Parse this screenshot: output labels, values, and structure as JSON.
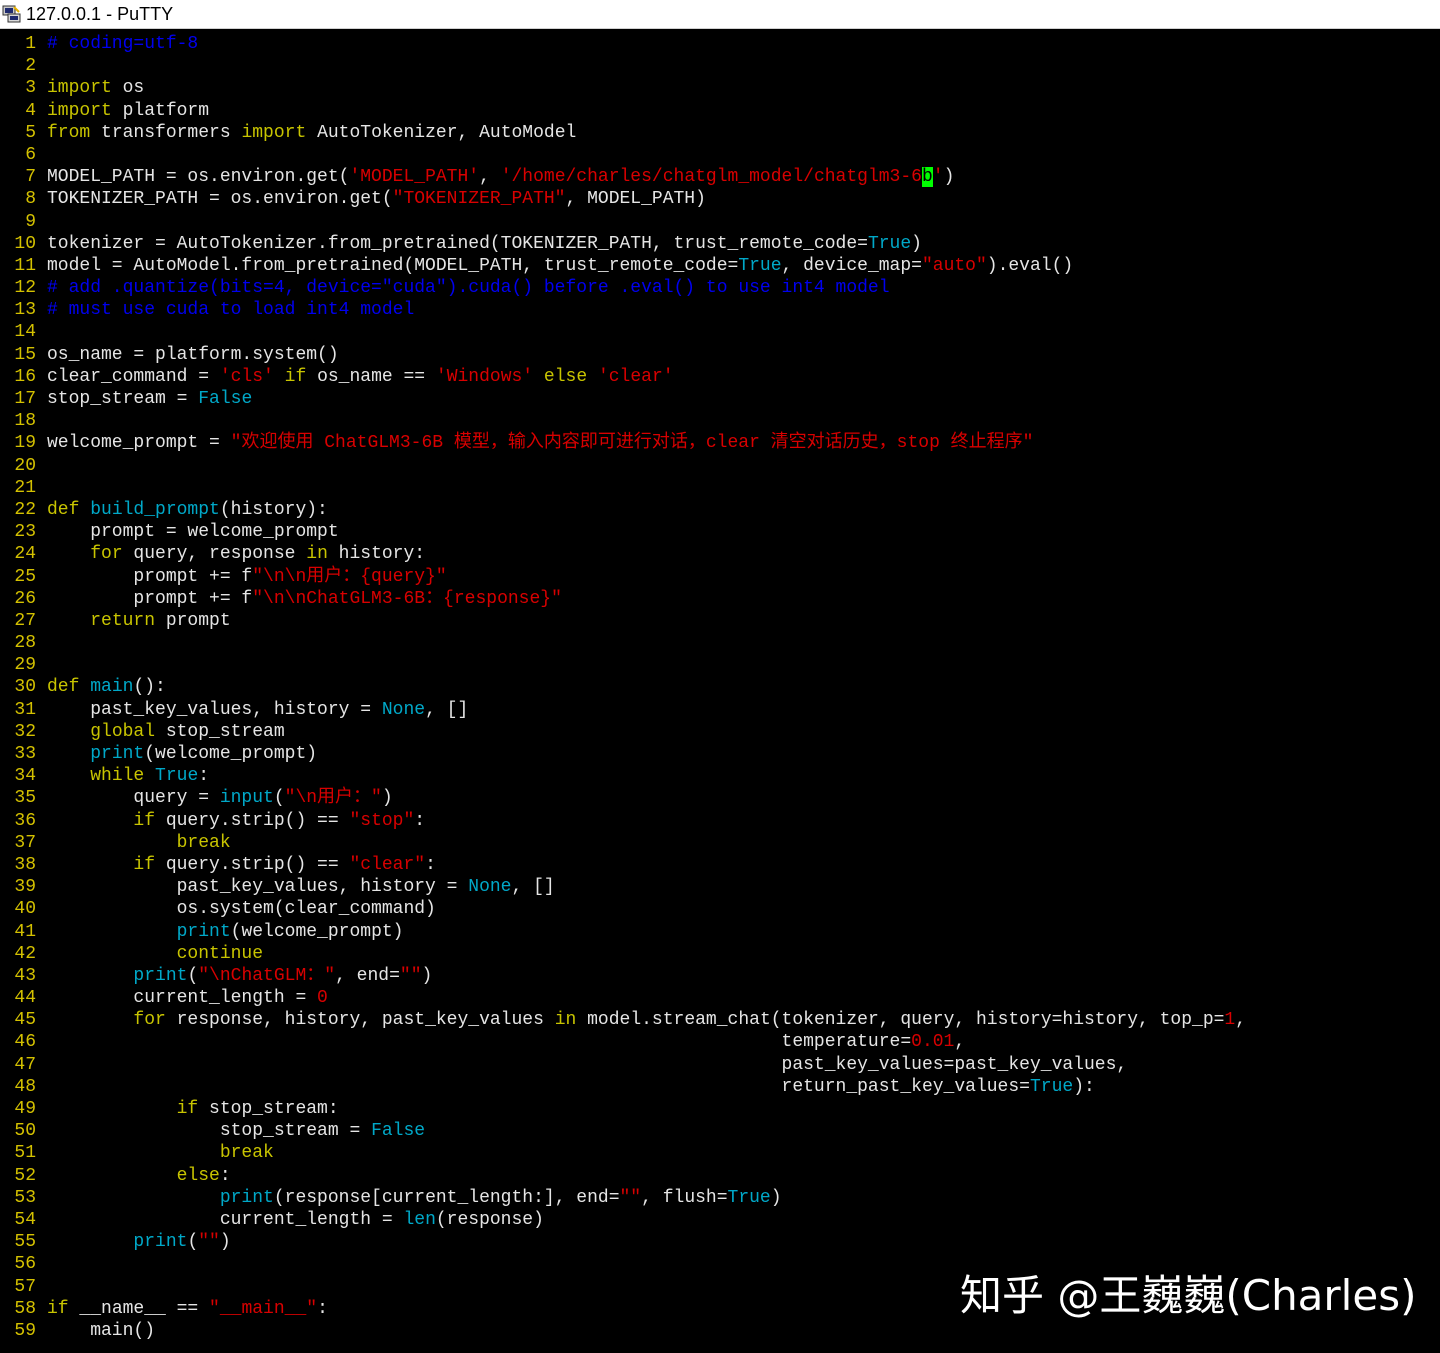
{
  "window": {
    "title": "127.0.0.1 - PuTTY",
    "icon": "putty-icon"
  },
  "watermark": "知乎 @王巍巍(Charles)",
  "colors": {
    "background": "#000000",
    "plain": "#e5e5e5",
    "line_number": "#d4c100",
    "keyword": "#c8c400",
    "builtin": "#00a8c8",
    "string": "#d80000",
    "comment": "#0000ee",
    "cursor": "#00ff00"
  },
  "lines": [
    {
      "n": "1",
      "t": [
        [
          "cm",
          "# coding=utf-8"
        ]
      ]
    },
    {
      "n": "2",
      "t": []
    },
    {
      "n": "3",
      "t": [
        [
          "kw",
          "import"
        ],
        [
          "p",
          " os"
        ]
      ]
    },
    {
      "n": "4",
      "t": [
        [
          "kw",
          "import"
        ],
        [
          "p",
          " platform"
        ]
      ]
    },
    {
      "n": "5",
      "t": [
        [
          "kw",
          "from"
        ],
        [
          "p",
          " transformers "
        ],
        [
          "kw",
          "import"
        ],
        [
          "p",
          " AutoTokenizer, AutoModel"
        ]
      ]
    },
    {
      "n": "6",
      "t": []
    },
    {
      "n": "7",
      "t": [
        [
          "p",
          "MODEL_PATH = os.environ.get("
        ],
        [
          "st",
          "'MODEL_PATH'"
        ],
        [
          "p",
          ", "
        ],
        [
          "st",
          "'/home/charles/chatglm_model/chatglm3-6"
        ],
        [
          "cur",
          "b"
        ],
        [
          "st",
          "'"
        ],
        [
          "p",
          ")"
        ]
      ]
    },
    {
      "n": "8",
      "t": [
        [
          "p",
          "TOKENIZER_PATH = os.environ.get("
        ],
        [
          "st",
          "\"TOKENIZER_PATH\""
        ],
        [
          "p",
          ", MODEL_PATH)"
        ]
      ]
    },
    {
      "n": "9",
      "t": []
    },
    {
      "n": "10",
      "t": [
        [
          "p",
          "tokenizer = AutoTokenizer.from_pretrained(TOKENIZER_PATH, trust_remote_code="
        ],
        [
          "bi",
          "True"
        ],
        [
          "p",
          ")"
        ]
      ]
    },
    {
      "n": "11",
      "t": [
        [
          "p",
          "model = AutoModel.from_pretrained(MODEL_PATH, trust_remote_code="
        ],
        [
          "bi",
          "True"
        ],
        [
          "p",
          ", device_map="
        ],
        [
          "st",
          "\"auto\""
        ],
        [
          "p",
          ").eval()"
        ]
      ]
    },
    {
      "n": "12",
      "t": [
        [
          "cm",
          "# add .quantize(bits=4, device=\"cuda\").cuda() before .eval() to use int4 model"
        ]
      ]
    },
    {
      "n": "13",
      "t": [
        [
          "cm",
          "# must use cuda to load int4 model"
        ]
      ]
    },
    {
      "n": "14",
      "t": []
    },
    {
      "n": "15",
      "t": [
        [
          "p",
          "os_name = platform.system()"
        ]
      ]
    },
    {
      "n": "16",
      "t": [
        [
          "p",
          "clear_command = "
        ],
        [
          "st",
          "'cls'"
        ],
        [
          "p",
          " "
        ],
        [
          "kw",
          "if"
        ],
        [
          "p",
          " os_name == "
        ],
        [
          "st",
          "'Windows'"
        ],
        [
          "p",
          " "
        ],
        [
          "kw",
          "else"
        ],
        [
          "p",
          " "
        ],
        [
          "st",
          "'clear'"
        ]
      ]
    },
    {
      "n": "17",
      "t": [
        [
          "p",
          "stop_stream = "
        ],
        [
          "bi",
          "False"
        ]
      ]
    },
    {
      "n": "18",
      "t": []
    },
    {
      "n": "19",
      "t": [
        [
          "p",
          "welcome_prompt = "
        ],
        [
          "st",
          "\"欢迎使用 ChatGLM3-6B 模型，输入内容即可进行对话，clear 清空对话历史，stop 终止程序\""
        ]
      ]
    },
    {
      "n": "20",
      "t": []
    },
    {
      "n": "21",
      "t": []
    },
    {
      "n": "22",
      "t": [
        [
          "kw",
          "def"
        ],
        [
          "p",
          " "
        ],
        [
          "bi",
          "build_prompt"
        ],
        [
          "p",
          "(history):"
        ]
      ]
    },
    {
      "n": "23",
      "t": [
        [
          "p",
          "    prompt = welcome_prompt"
        ]
      ]
    },
    {
      "n": "24",
      "t": [
        [
          "p",
          "    "
        ],
        [
          "kw",
          "for"
        ],
        [
          "p",
          " query, response "
        ],
        [
          "kw",
          "in"
        ],
        [
          "p",
          " history:"
        ]
      ]
    },
    {
      "n": "25",
      "t": [
        [
          "p",
          "        prompt += f"
        ],
        [
          "st",
          "\"\\n\\n用户：{query}\""
        ]
      ]
    },
    {
      "n": "26",
      "t": [
        [
          "p",
          "        prompt += f"
        ],
        [
          "st",
          "\"\\n\\nChatGLM3-6B：{response}\""
        ]
      ]
    },
    {
      "n": "27",
      "t": [
        [
          "p",
          "    "
        ],
        [
          "kw",
          "return"
        ],
        [
          "p",
          " prompt"
        ]
      ]
    },
    {
      "n": "28",
      "t": []
    },
    {
      "n": "29",
      "t": []
    },
    {
      "n": "30",
      "t": [
        [
          "kw",
          "def"
        ],
        [
          "p",
          " "
        ],
        [
          "bi",
          "main"
        ],
        [
          "p",
          "():"
        ]
      ]
    },
    {
      "n": "31",
      "t": [
        [
          "p",
          "    past_key_values, history = "
        ],
        [
          "bi",
          "None"
        ],
        [
          "p",
          ", []"
        ]
      ]
    },
    {
      "n": "32",
      "t": [
        [
          "p",
          "    "
        ],
        [
          "kw",
          "global"
        ],
        [
          "p",
          " stop_stream"
        ]
      ]
    },
    {
      "n": "33",
      "t": [
        [
          "p",
          "    "
        ],
        [
          "bi",
          "print"
        ],
        [
          "p",
          "(welcome_prompt)"
        ]
      ]
    },
    {
      "n": "34",
      "t": [
        [
          "p",
          "    "
        ],
        [
          "kw",
          "while"
        ],
        [
          "p",
          " "
        ],
        [
          "bi",
          "True"
        ],
        [
          "p",
          ":"
        ]
      ]
    },
    {
      "n": "35",
      "t": [
        [
          "p",
          "        query = "
        ],
        [
          "bi",
          "input"
        ],
        [
          "p",
          "("
        ],
        [
          "st",
          "\"\\n用户：\""
        ],
        [
          "p",
          ")"
        ]
      ]
    },
    {
      "n": "36",
      "t": [
        [
          "p",
          "        "
        ],
        [
          "kw",
          "if"
        ],
        [
          "p",
          " query.strip() == "
        ],
        [
          "st",
          "\"stop\""
        ],
        [
          "p",
          ":"
        ]
      ]
    },
    {
      "n": "37",
      "t": [
        [
          "p",
          "            "
        ],
        [
          "kw",
          "break"
        ]
      ]
    },
    {
      "n": "38",
      "t": [
        [
          "p",
          "        "
        ],
        [
          "kw",
          "if"
        ],
        [
          "p",
          " query.strip() == "
        ],
        [
          "st",
          "\"clear\""
        ],
        [
          "p",
          ":"
        ]
      ]
    },
    {
      "n": "39",
      "t": [
        [
          "p",
          "            past_key_values, history = "
        ],
        [
          "bi",
          "None"
        ],
        [
          "p",
          ", []"
        ]
      ]
    },
    {
      "n": "40",
      "t": [
        [
          "p",
          "            os.system(clear_command)"
        ]
      ]
    },
    {
      "n": "41",
      "t": [
        [
          "p",
          "            "
        ],
        [
          "bi",
          "print"
        ],
        [
          "p",
          "(welcome_prompt)"
        ]
      ]
    },
    {
      "n": "42",
      "t": [
        [
          "p",
          "            "
        ],
        [
          "kw",
          "continue"
        ]
      ]
    },
    {
      "n": "43",
      "t": [
        [
          "p",
          "        "
        ],
        [
          "bi",
          "print"
        ],
        [
          "p",
          "("
        ],
        [
          "st",
          "\"\\nChatGLM：\""
        ],
        [
          "p",
          ", end="
        ],
        [
          "st",
          "\"\""
        ],
        [
          "p",
          ")"
        ]
      ]
    },
    {
      "n": "44",
      "t": [
        [
          "p",
          "        current_length = "
        ],
        [
          "st",
          "0"
        ]
      ]
    },
    {
      "n": "45",
      "t": [
        [
          "p",
          "        "
        ],
        [
          "kw",
          "for"
        ],
        [
          "p",
          " response, history, past_key_values "
        ],
        [
          "kw",
          "in"
        ],
        [
          "p",
          " model.stream_chat(tokenizer, query, history=history, top_p="
        ],
        [
          "st",
          "1"
        ],
        [
          "p",
          ","
        ]
      ]
    },
    {
      "n": "46",
      "t": [
        [
          "p",
          "                                                                    temperature="
        ],
        [
          "st",
          "0.01"
        ],
        [
          "p",
          ","
        ]
      ]
    },
    {
      "n": "47",
      "t": [
        [
          "p",
          "                                                                    past_key_values=past_key_values,"
        ]
      ]
    },
    {
      "n": "48",
      "t": [
        [
          "p",
          "                                                                    return_past_key_values="
        ],
        [
          "bi",
          "True"
        ],
        [
          "p",
          "):"
        ]
      ]
    },
    {
      "n": "49",
      "t": [
        [
          "p",
          "            "
        ],
        [
          "kw",
          "if"
        ],
        [
          "p",
          " stop_stream:"
        ]
      ]
    },
    {
      "n": "50",
      "t": [
        [
          "p",
          "                stop_stream = "
        ],
        [
          "bi",
          "False"
        ]
      ]
    },
    {
      "n": "51",
      "t": [
        [
          "p",
          "                "
        ],
        [
          "kw",
          "break"
        ]
      ]
    },
    {
      "n": "52",
      "t": [
        [
          "p",
          "            "
        ],
        [
          "kw",
          "else"
        ],
        [
          "p",
          ":"
        ]
      ]
    },
    {
      "n": "53",
      "t": [
        [
          "p",
          "                "
        ],
        [
          "bi",
          "print"
        ],
        [
          "p",
          "(response[current_length:], end="
        ],
        [
          "st",
          "\"\""
        ],
        [
          "p",
          ", flush="
        ],
        [
          "bi",
          "True"
        ],
        [
          "p",
          ")"
        ]
      ]
    },
    {
      "n": "54",
      "t": [
        [
          "p",
          "                current_length = "
        ],
        [
          "bi",
          "len"
        ],
        [
          "p",
          "(response)"
        ]
      ]
    },
    {
      "n": "55",
      "t": [
        [
          "p",
          "        "
        ],
        [
          "bi",
          "print"
        ],
        [
          "p",
          "("
        ],
        [
          "st",
          "\"\""
        ],
        [
          "p",
          ")"
        ]
      ]
    },
    {
      "n": "56",
      "t": []
    },
    {
      "n": "57",
      "t": []
    },
    {
      "n": "58",
      "t": [
        [
          "kw",
          "if"
        ],
        [
          "p",
          " __name__ == "
        ],
        [
          "st",
          "\"__main__\""
        ],
        [
          "p",
          ":"
        ]
      ]
    },
    {
      "n": "59",
      "t": [
        [
          "p",
          "    main()"
        ]
      ]
    }
  ]
}
